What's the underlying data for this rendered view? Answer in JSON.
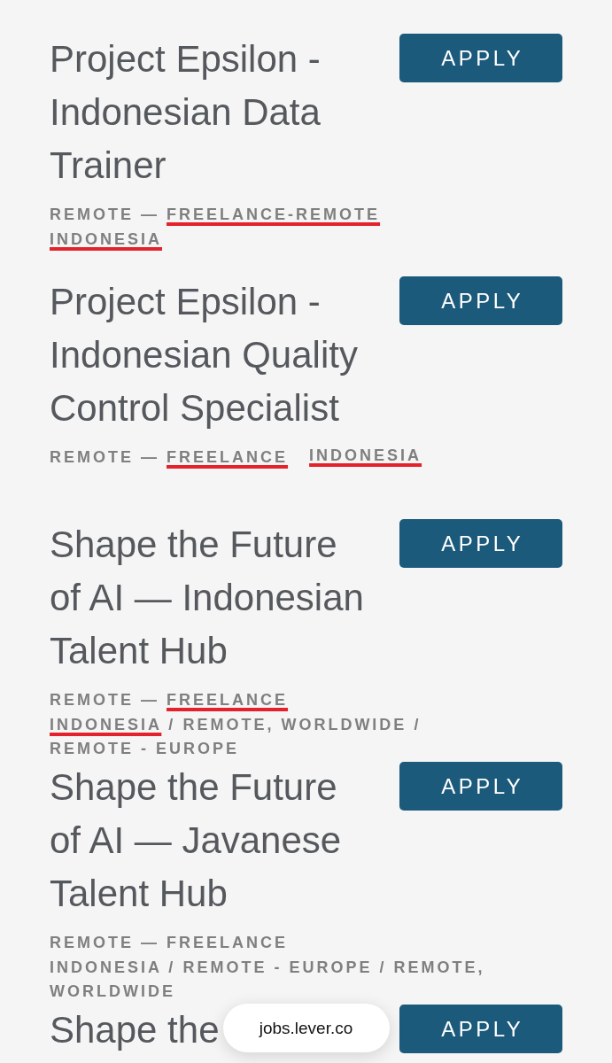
{
  "postings": [
    {
      "title": "Project Epsilon - Indonesian Data Trainer",
      "department": "REMOTE",
      "dash": "—",
      "team": {
        "text": "FREELANCE-REMOTE",
        "underlined": true
      },
      "locations": [
        {
          "name": "INDONESIA",
          "underlined": true
        }
      ],
      "apply": "APPLY"
    },
    {
      "title": "Project Epsilon - Indonesian Quality Control Specialist",
      "department": "REMOTE",
      "dash": "—",
      "team": {
        "text": "FREELANCE",
        "underlined": true
      },
      "locations": [
        {
          "name": "INDONESIA",
          "underlined": true
        }
      ],
      "apply": "APPLY"
    },
    {
      "title": "Shape the Future of AI — Indonesian Talent Hub",
      "department": "REMOTE",
      "dash": "—",
      "team": {
        "text": "FREELANCE",
        "underlined": true
      },
      "locations": [
        {
          "name": "INDONESIA",
          "underlined": true,
          "separator": "/"
        },
        {
          "name": "REMOTE, WORLDWIDE",
          "underlined": false,
          "separator": "/"
        },
        {
          "name": "REMOTE - EUROPE",
          "underlined": false
        }
      ],
      "apply": "APPLY"
    },
    {
      "title": "Shape the Future of AI — Javanese Talent Hub",
      "department": "REMOTE",
      "dash": "—",
      "team": {
        "text": "FREELANCE",
        "underlined": false
      },
      "locations": [
        {
          "name": "INDONESIA",
          "underlined": false,
          "separator": "/"
        },
        {
          "name": "REMOTE - EUROPE",
          "underlined": false,
          "separator": "/"
        },
        {
          "name": "REMOTE, WORLDWIDE",
          "underlined": false
        }
      ],
      "apply": "APPLY"
    },
    {
      "title": "Shape the",
      "apply": "APPLY"
    }
  ],
  "address_bar": {
    "url": "jobs.lever.co"
  }
}
